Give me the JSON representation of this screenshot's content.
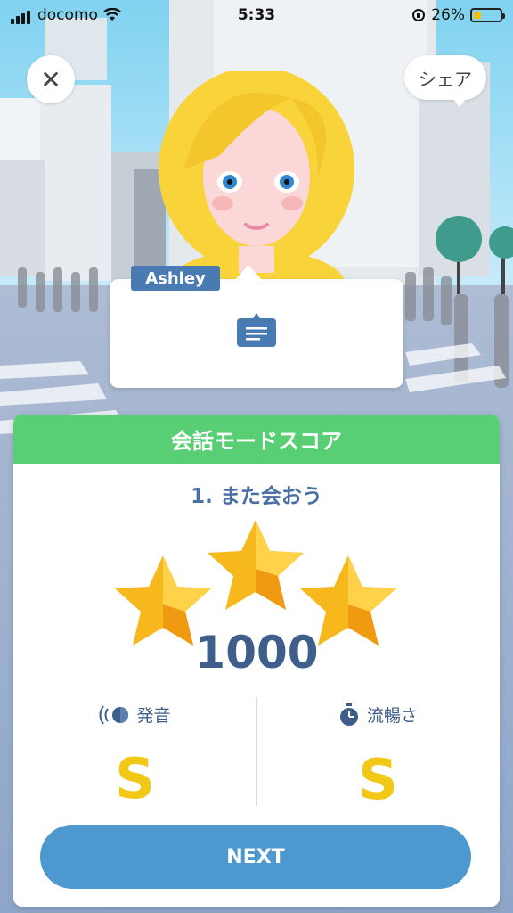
{
  "status_bar": {
    "carrier": "docomo",
    "time": "5:33",
    "battery": "26%"
  },
  "top": {
    "close_icon": "close-icon",
    "share_label": "シェア"
  },
  "character": {
    "name": "Ashley"
  },
  "speech": {
    "icon": "message-icon"
  },
  "score_card": {
    "title": "会話モードスコア",
    "lesson": "1. また会おう",
    "stars_earned": 3,
    "stars_total": 3,
    "score": "1000",
    "pronunciation": {
      "label": "発音",
      "grade": "S",
      "icon": "sound-icon"
    },
    "fluency": {
      "label": "流暢さ",
      "grade": "S",
      "icon": "stopwatch-icon"
    },
    "next_label": "NEXT"
  },
  "colors": {
    "green": "#58cf74",
    "blue": "#4c98cf",
    "star": "#f7b81d",
    "grade": "#f2c816"
  }
}
